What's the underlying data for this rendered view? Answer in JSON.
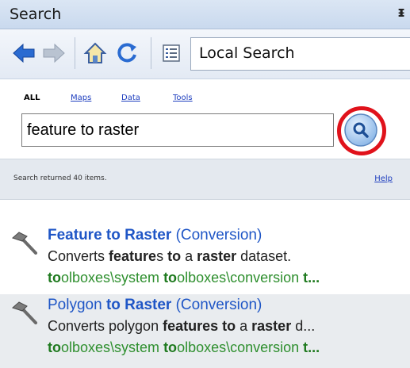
{
  "window": {
    "title": "Search",
    "pin_glyph": "ᵻ"
  },
  "toolbar": {
    "icons": [
      "back-arrow-icon",
      "forward-arrow-icon",
      "home-icon",
      "refresh-icon",
      "search-options-icon"
    ],
    "location_label": "Local Search"
  },
  "filters": [
    {
      "label": "ALL",
      "active": true
    },
    {
      "label": "Maps",
      "active": false
    },
    {
      "label": "Data",
      "active": false
    },
    {
      "label": "Tools",
      "active": false
    }
  ],
  "search": {
    "query": "feature to raster",
    "button_icon": "magnifier-icon",
    "highlight_color": "#e0121b"
  },
  "status": {
    "text": "Search returned 40 items.",
    "help_label": "Help"
  },
  "results": [
    {
      "name": "Feature to Raster",
      "category": "(Conversion)",
      "desc_parts": [
        "Converts ",
        "feature",
        "s ",
        "to",
        " a ",
        "raster",
        " dataset."
      ],
      "path_parts": [
        "to",
        "olboxes\\system ",
        "to",
        "olboxes\\conversion ",
        "t..."
      ]
    },
    {
      "name_parts": [
        "Polygon ",
        "to Raster"
      ],
      "category": "(Conversion)",
      "desc_parts": [
        "Converts polygon ",
        "features",
        " ",
        "to",
        " a ",
        "raster",
        " d..."
      ],
      "path_parts": [
        "to",
        "olboxes\\system ",
        "to",
        "olboxes\\conversion ",
        "t..."
      ]
    }
  ],
  "colors": {
    "link": "#1f56c6",
    "path_green": "#2e8f2e",
    "titlebar": "#c9d9ee"
  }
}
